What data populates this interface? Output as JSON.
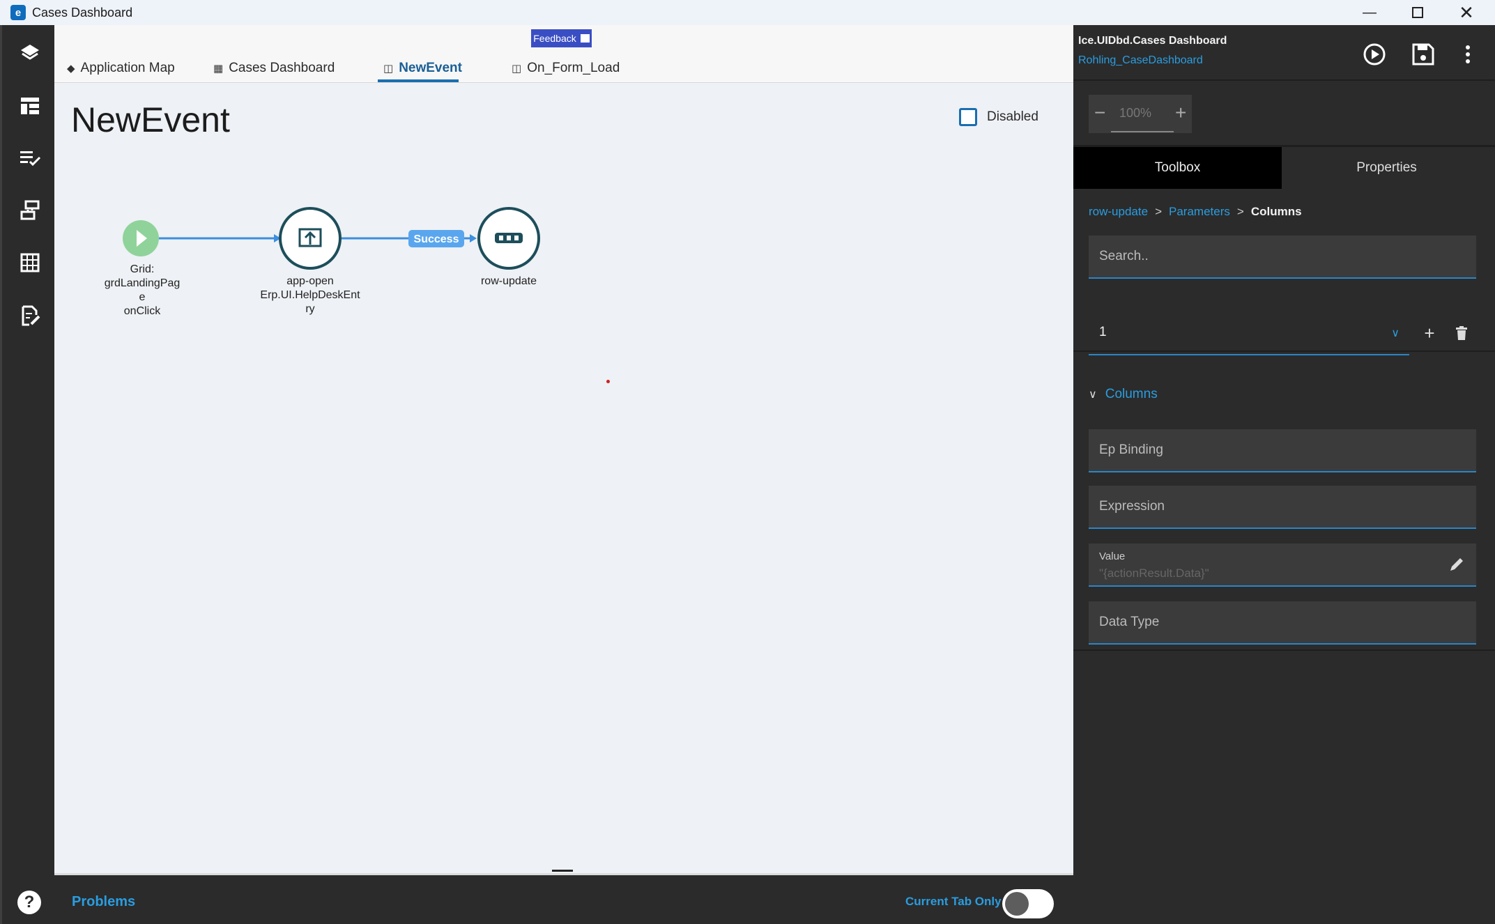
{
  "window": {
    "title": "Cases Dashboard"
  },
  "tabs": [
    {
      "label": "Application Map"
    },
    {
      "label": "Cases Dashboard"
    },
    {
      "label": "NewEvent"
    },
    {
      "label": "On_Form_Load"
    }
  ],
  "feedback_label": "Feedback",
  "canvas": {
    "title": "NewEvent",
    "disabled_label": "Disabled",
    "nodes": [
      {
        "lines": [
          "Grid:",
          "grdLandingPag",
          "e",
          "onClick"
        ]
      },
      {
        "lines": [
          "app-open",
          "Erp.UI.HelpDeskEnt",
          "ry"
        ]
      },
      {
        "lines": [
          "row-update"
        ]
      }
    ],
    "edge_label": "Success"
  },
  "bottom": {
    "problems": "Problems",
    "current_tab_only": "Current Tab Only"
  },
  "panel": {
    "title": "Ice.UIDbd.Cases Dashboard",
    "subtitle": "Rohling_CaseDashboard",
    "zoom": "100%",
    "tabs": {
      "toolbox": "Toolbox",
      "properties": "Properties"
    },
    "breadcrumb": [
      "row-update",
      "Parameters",
      "Columns"
    ],
    "breadcrumb_sep": ">",
    "search_placeholder": "Search..",
    "selected_index": "1",
    "section": "Columns",
    "fields": {
      "ep_binding": "Ep Binding",
      "expression": "Expression",
      "value_label": "Value",
      "value": "\"{actionResult.Data}\"",
      "data_type": "Data Type"
    }
  },
  "colors": {
    "accent": "#2a9de0",
    "node_ring": "#1d4e5b",
    "start_node": "#8fd39a",
    "edge": "#3d8fe0"
  }
}
